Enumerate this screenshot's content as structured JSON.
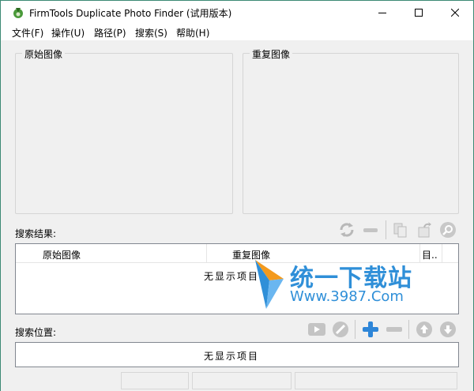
{
  "window": {
    "title": "FirmTools Duplicate Photo Finder (试用版本)",
    "border_color": "#3c8a74"
  },
  "menu": [
    "文件(F)",
    "操作(U)",
    "路径(P)",
    "搜索(S)",
    "帮助(H)"
  ],
  "preview": {
    "original_label": "原始图像",
    "duplicate_label": "重复图像"
  },
  "results": {
    "label": "搜索结果:",
    "columns": [
      "原始图像",
      "重复图像",
      "目.."
    ],
    "empty_text": "无显示项目"
  },
  "locations": {
    "label": "搜索位置:",
    "empty_text": "无显示项目"
  },
  "watermark": {
    "brand_text": "统一下载站",
    "url_text": "Www.3987.Com"
  },
  "icons": {
    "results_toolbar": [
      "refresh-icon",
      "remove-icon",
      "copy-icon",
      "move-icon",
      "search-zoom-icon"
    ],
    "locations_toolbar": [
      "play-icon",
      "stop-icon",
      "add-icon",
      "minus-icon",
      "up-icon",
      "down-icon"
    ],
    "accent": "#2f8fd8"
  }
}
